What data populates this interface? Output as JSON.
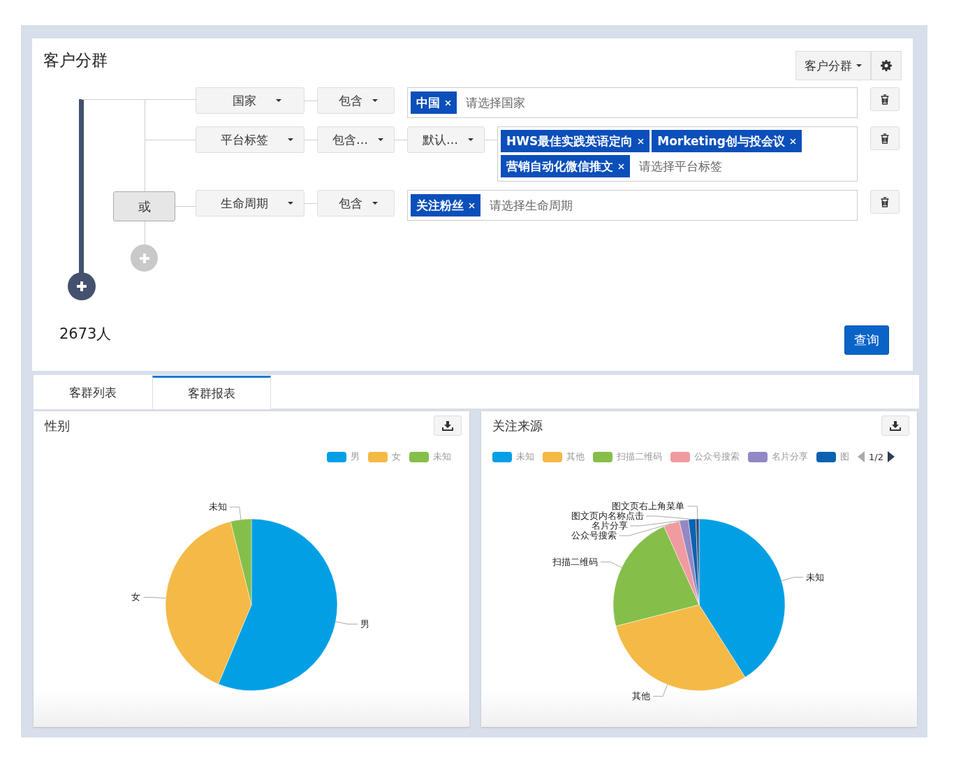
{
  "header": {
    "title": "客户分群",
    "view_button": "客户分群"
  },
  "conditions": [
    {
      "selects": [
        "国家",
        "包含"
      ],
      "tags": [
        "中国"
      ],
      "placeholder": "请选择国家"
    },
    {
      "selects": [
        "平台标签",
        "包含…",
        "默认…"
      ],
      "tags": [
        "HWS最佳实践英语定向",
        "Morketing创与投会议",
        "营销自动化微信推文"
      ],
      "placeholder": "请选择平台标签"
    },
    {
      "selects": [
        "生命周期",
        "包含"
      ],
      "tags": [
        "关注粉丝"
      ],
      "placeholder": "请选择生命周期"
    }
  ],
  "or_button": "或",
  "count": "2673人",
  "query_button": "查询",
  "tabs": [
    {
      "label": "客群列表",
      "selected": false
    },
    {
      "label": "客群报表",
      "selected": true
    }
  ],
  "panels": [
    {
      "title": "性别",
      "legend": [
        {
          "label": "男",
          "color": "#039fe5"
        },
        {
          "label": "女",
          "color": "#f5b945"
        },
        {
          "label": "未知",
          "color": "#86be4a"
        }
      ],
      "chart_data": {
        "type": "pie",
        "categories": [
          "男",
          "女",
          "未知"
        ],
        "colors": [
          "#039fe5",
          "#f5b945",
          "#86be4a"
        ],
        "series": [
          {
            "values": [
              0.563,
              0.398,
              0.039
            ]
          }
        ]
      }
    },
    {
      "title": "关注来源",
      "legend": [
        {
          "label": "未知",
          "color": "#039fe5"
        },
        {
          "label": "其他",
          "color": "#f5b945"
        },
        {
          "label": "扫描二维码",
          "color": "#86be4a"
        },
        {
          "label": "公众号搜索",
          "color": "#f09b9f"
        },
        {
          "label": "名片分享",
          "color": "#9388c4"
        },
        {
          "label": "图",
          "color": "#0b62b0"
        }
      ],
      "legend_page": "1/2",
      "chart_data": {
        "type": "pie",
        "categories": [
          "未知",
          "其他",
          "扫描二维码",
          "公众号搜索",
          "名片分享",
          "图文页内名称点击",
          "图文页右上角菜单"
        ],
        "colors": [
          "#039fe5",
          "#f5b945",
          "#86be4a",
          "#f09b9f",
          "#9388c4",
          "#0b62b0",
          "#3d4f70"
        ],
        "series": [
          {
            "values": [
              0.41,
              0.3,
              0.223,
              0.03,
              0.017,
              0.014,
              0.006
            ]
          }
        ]
      }
    }
  ]
}
